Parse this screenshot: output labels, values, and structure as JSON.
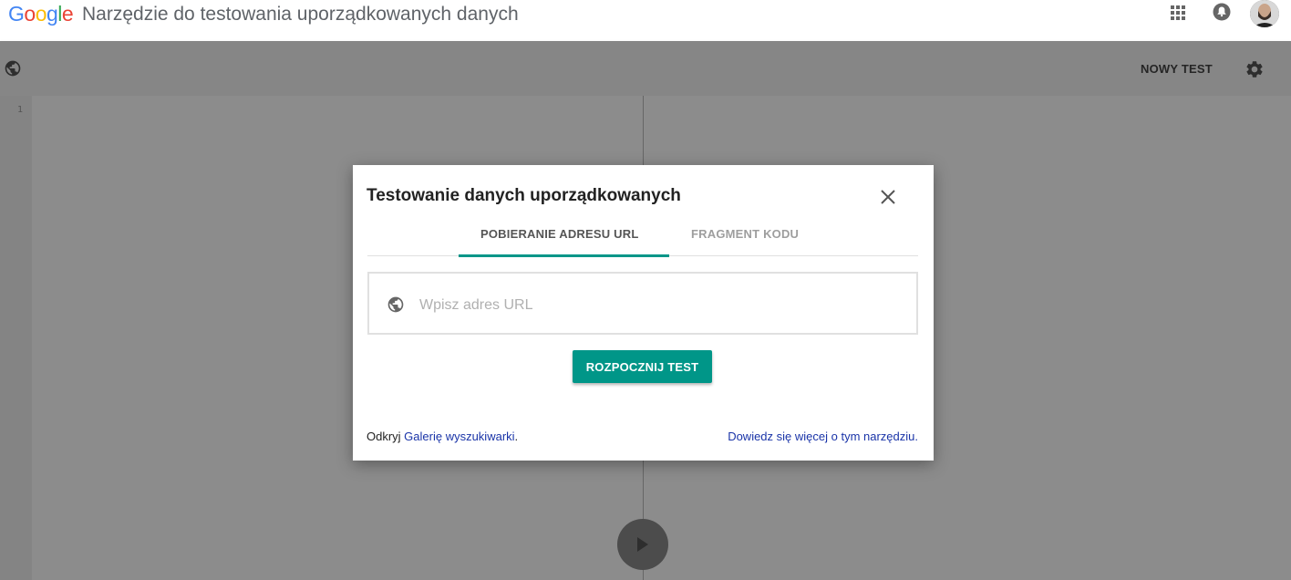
{
  "header": {
    "logo_letters": [
      "G",
      "o",
      "o",
      "g",
      "l",
      "e"
    ],
    "logo_colors": [
      "#4285F4",
      "#EA4335",
      "#FBBC05",
      "#4285F4",
      "#34A853",
      "#EA4335"
    ],
    "title": "Narzędzie do testowania uporządkowanych danych",
    "icons": [
      "apps-icon",
      "bell-icon",
      "avatar"
    ]
  },
  "toolbar": {
    "new_test_label": "NOWY TEST",
    "icons": [
      "globe-icon",
      "settings-icon"
    ]
  },
  "editor": {
    "line_number": "1"
  },
  "dialog": {
    "title": "Testowanie danych uporządkowanych",
    "tabs": [
      {
        "label": "POBIERANIE ADRESU URL",
        "active": true
      },
      {
        "label": "FRAGMENT KODU",
        "active": false
      }
    ],
    "url_placeholder": "Wpisz adres URL",
    "url_value": "",
    "start_button_label": "ROZPOCZNIJ TEST",
    "footer_prefix": "Odkryj ",
    "footer_link": "Galerię wyszukiwarki",
    "footer_suffix": ".",
    "learn_more_link": "Dowiedz się więcej o tym narzędziu.",
    "accent_color": "#009688",
    "link_color": "#1a34a8"
  }
}
